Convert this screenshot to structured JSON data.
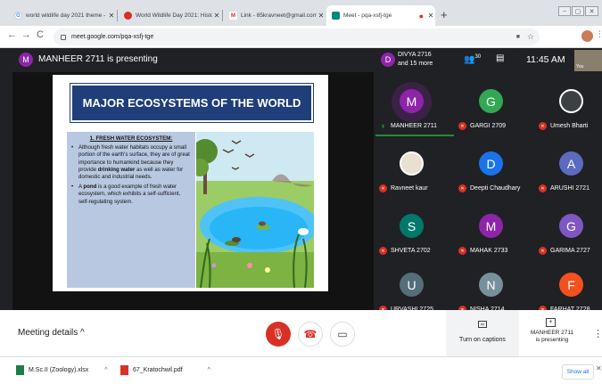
{
  "tabs": [
    {
      "title": "world wildlife day 2021 theme - ",
      "icon": "google-icon",
      "color": "#4285f4",
      "letter": "G"
    },
    {
      "title": "World Wildlife Day 2021: Histor",
      "icon": "news-icon",
      "color": "#d93025",
      "letter": "●"
    },
    {
      "title": "Link - 85kravneet@gmail.com - ",
      "icon": "gmail-icon",
      "color": "#d93025",
      "letter": "M"
    },
    {
      "title": "Meet - pqa-xsfj-tge",
      "icon": "meet-icon",
      "color": "#00897b",
      "letter": "▶"
    }
  ],
  "url": "meet.google.com/pqa-xsfj-tge",
  "presenter": {
    "initial": "M",
    "text": "MANHEER 2711 is presenting",
    "color": "#8e24aa"
  },
  "divya": {
    "initial": "D",
    "line1": "DIVYA 2716",
    "line2": "and 15 more",
    "color": "#8e24aa"
  },
  "participants_count": "30",
  "time": "11:45 AM",
  "you_label": "You",
  "slide": {
    "title": "MAJOR ECOSYSTEMS OF THE WORLD",
    "heading": "1. FRESH WATER ECOSYSTEM:",
    "b1_pre": "Although fresh water habitats occupy a small portion of the earth's surface, they are of great importance to humankind because they provide ",
    "b1_bold": "drinking water",
    "b1_post": " as well as water for domestic and industrial needs.",
    "b2_pre": "A ",
    "b2_bold": "pond",
    "b2_post": " is a good example of fresh water ecosystem, which exhibits a self-sufficient, self-regulating system."
  },
  "tiles": [
    {
      "name": "MANHEER 2711",
      "initial": "M",
      "color": "#8e24aa",
      "photo": false,
      "speaking": true
    },
    {
      "name": "GARGI 2709",
      "initial": "G",
      "color": "#33a852",
      "photo": false
    },
    {
      "name": "Umesh Bharti",
      "initial": "",
      "color": "#3c4043",
      "photo": true
    },
    {
      "name": "Ravneet kaur",
      "initial": "",
      "color": "#e8e0d0",
      "photo": true
    },
    {
      "name": "Deepti Chaudhary",
      "initial": "D",
      "color": "#1a73e8",
      "photo": false
    },
    {
      "name": "ARUSHI 2721",
      "initial": "A",
      "color": "#5c6bc0",
      "photo": false
    },
    {
      "name": "SHVETA 2702",
      "initial": "S",
      "color": "#00796b",
      "photo": false
    },
    {
      "name": "MAHAK 2733",
      "initial": "M",
      "color": "#8e24aa",
      "photo": false
    },
    {
      "name": "GARIMA 2727",
      "initial": "G",
      "color": "#7e57c2",
      "photo": false
    },
    {
      "name": "URVASHI 2725",
      "initial": "U",
      "color": "#546e7a",
      "photo": false
    },
    {
      "name": "NISHA 2714",
      "initial": "N",
      "color": "#78909c",
      "photo": false
    },
    {
      "name": "FARHAT 2728",
      "initial": "F",
      "color": "#f4511e",
      "photo": false
    }
  ],
  "bottom": {
    "details": "Meeting details",
    "captions": "Turn on captions",
    "presenting_line1": "MANHEER 2711",
    "presenting_line2": "is presenting"
  },
  "downloads": [
    {
      "name": "M.Sc.II (Zoology).xlsx",
      "icon": "excel-file-icon"
    },
    {
      "name": "67_Kratochwil.pdf",
      "icon": "pdf-file-icon"
    }
  ],
  "show_all": "Show all"
}
